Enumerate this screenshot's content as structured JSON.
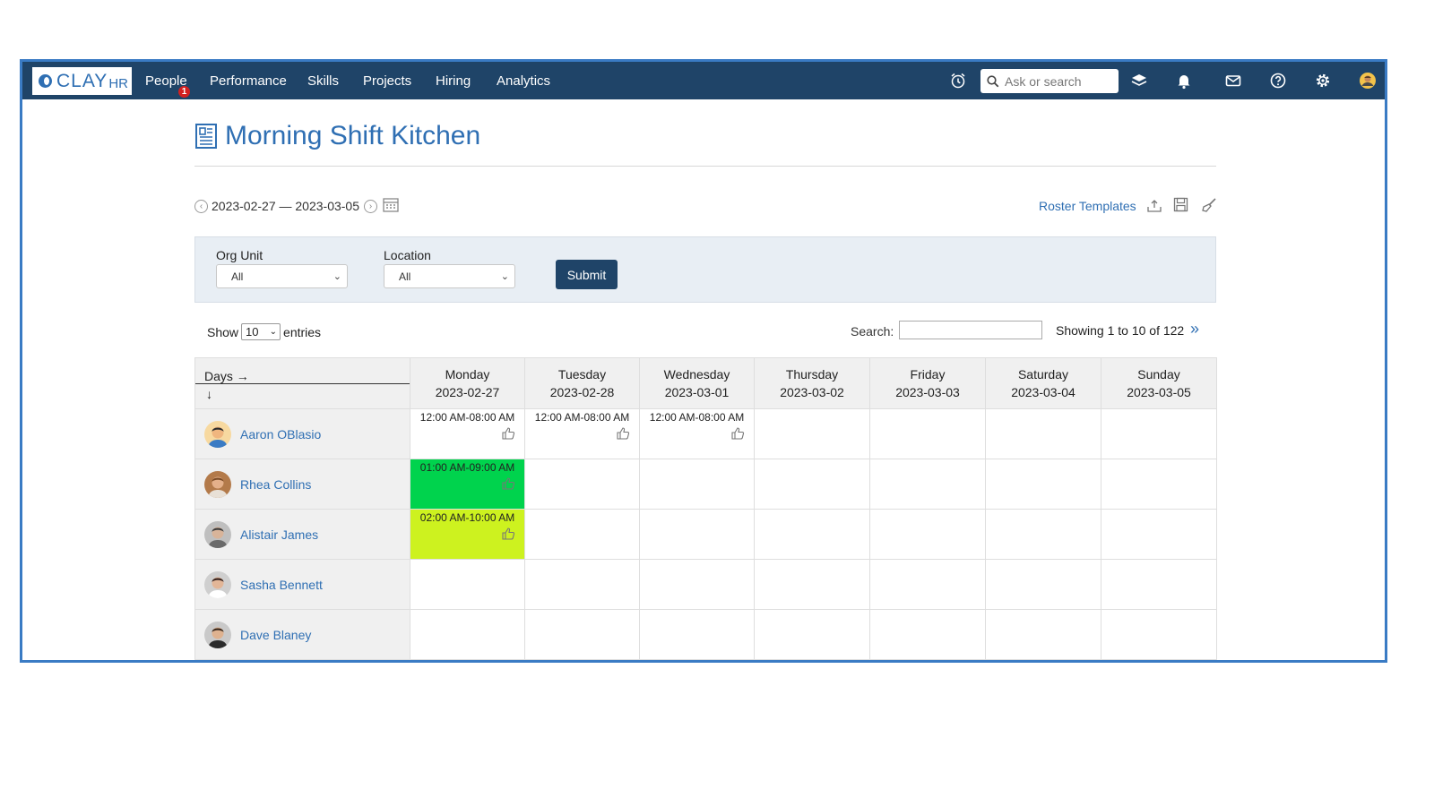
{
  "app": {
    "logo_text": "CLAY",
    "logo_suffix": "HR"
  },
  "nav": {
    "items": [
      "People",
      "Performance",
      "Skills",
      "Projects",
      "Hiring",
      "Analytics"
    ],
    "people_badge": "1",
    "search_placeholder": "Ask or search",
    "icons": [
      "alarm-clock-icon",
      "layers-icon",
      "bell-icon",
      "mail-icon",
      "help-icon",
      "gear-icon",
      "user-avatar"
    ]
  },
  "page": {
    "title": "Morning Shift Kitchen",
    "date_range": "2023-02-27 — 2023-03-05",
    "roster_templates": "Roster Templates"
  },
  "filters": {
    "org_unit_label": "Org Unit",
    "org_unit_value": "All",
    "location_label": "Location",
    "location_value": "All",
    "submit_label": "Submit"
  },
  "table_controls": {
    "show_label": "Show",
    "entries_value": "10",
    "entries_label": "entries",
    "search_label": "Search:",
    "showing_text": "Showing 1 to 10 of 122",
    "next_symbol": "»"
  },
  "grid": {
    "corner_label": "Days →",
    "corner_down": "↓",
    "days": [
      {
        "name": "Monday",
        "date": "2023-02-27"
      },
      {
        "name": "Tuesday",
        "date": "2023-02-28"
      },
      {
        "name": "Wednesday",
        "date": "2023-03-01"
      },
      {
        "name": "Thursday",
        "date": "2023-03-02"
      },
      {
        "name": "Friday",
        "date": "2023-03-03"
      },
      {
        "name": "Saturday",
        "date": "2023-03-04"
      },
      {
        "name": "Sunday",
        "date": "2023-03-05"
      }
    ],
    "employees": [
      {
        "name": "Aaron OBlasio",
        "shifts": [
          "12:00 AM-08:00 AM",
          "12:00 AM-08:00 AM",
          "12:00 AM-08:00 AM",
          "",
          "",
          "",
          ""
        ],
        "colors": [
          "",
          "",
          "",
          "",
          "",
          "",
          ""
        ]
      },
      {
        "name": "Rhea Collins",
        "shifts": [
          "01:00 AM-09:00 AM",
          "",
          "",
          "",
          "",
          "",
          ""
        ],
        "colors": [
          "#00d34d",
          "",
          "",
          "",
          "",
          "",
          ""
        ]
      },
      {
        "name": "Alistair James",
        "shifts": [
          "02:00 AM-10:00 AM",
          "",
          "",
          "",
          "",
          "",
          ""
        ],
        "colors": [
          "#cdf21f",
          "",
          "",
          "",
          "",
          "",
          ""
        ]
      },
      {
        "name": "Sasha Bennett",
        "shifts": [
          "",
          "",
          "",
          "",
          "",
          "",
          ""
        ],
        "colors": [
          "",
          "",
          "",
          "",
          "",
          "",
          ""
        ]
      },
      {
        "name": "Dave Blaney",
        "shifts": [
          "",
          "",
          "",
          "",
          "",
          "",
          ""
        ],
        "colors": [
          "",
          "",
          "",
          "",
          "",
          "",
          ""
        ]
      }
    ]
  }
}
